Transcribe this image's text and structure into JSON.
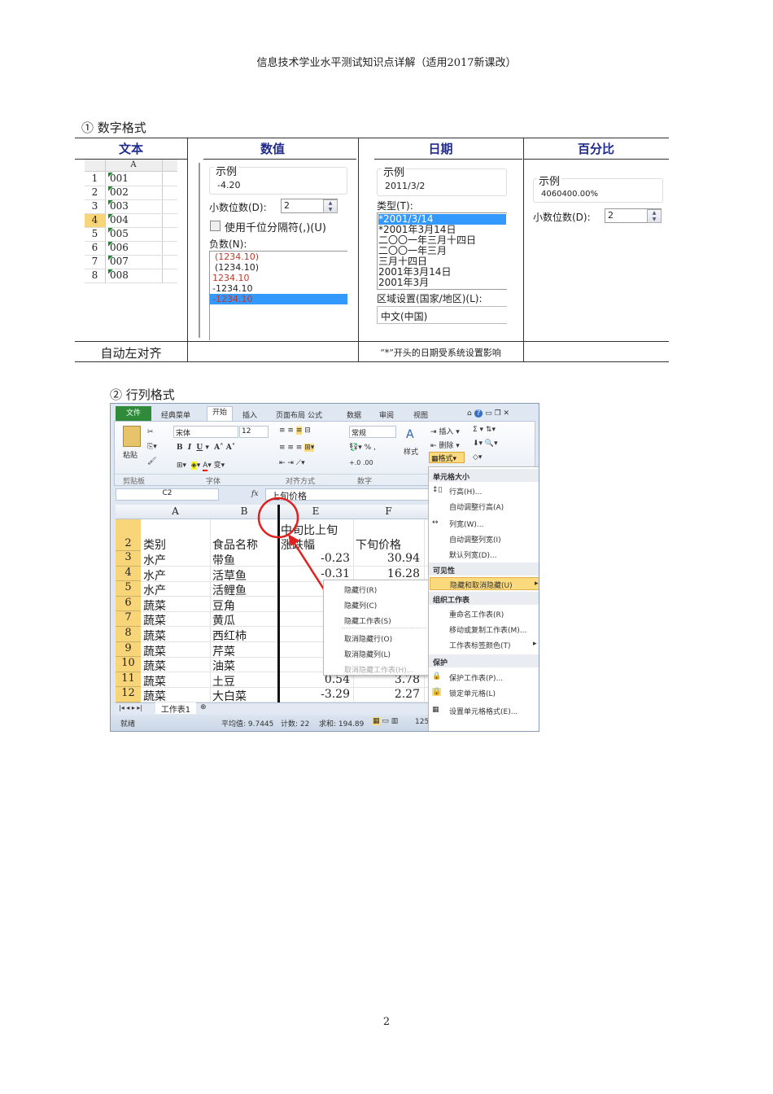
{
  "header": "信息技术学业水平测试知识点详解（适用2017新课改）",
  "section1": {
    "title": "① 数字格式",
    "columns": [
      "文本",
      "数值",
      "日期",
      "百分比"
    ],
    "text": {
      "col_header": "A",
      "rows": [
        "1",
        "2",
        "3",
        "4",
        "5",
        "6",
        "7",
        "8"
      ],
      "values": [
        "001",
        "002",
        "003",
        "004",
        "005",
        "006",
        "007",
        "008"
      ],
      "note": "自动左对齐"
    },
    "number": {
      "sample_label": "示例",
      "sample": "-4.20",
      "decimals_label": "小数位数(D):",
      "decimals": "2",
      "thousands_label": "使用千位分隔符(,)(U)",
      "negative_label": "负数(N):",
      "negatives": [
        "(1234.10)",
        "(1234.10)",
        "1234.10",
        "-1234.10",
        "-1234.10"
      ]
    },
    "date": {
      "sample_label": "示例",
      "sample": "2011/3/2",
      "type_label": "类型(T):",
      "types": [
        "*2001/3/14",
        "*2001年3月14日",
        "二〇〇一年三月十四日",
        "二〇〇一年三月",
        "三月十四日",
        "2001年3月14日",
        "2001年3月"
      ],
      "locale_label": "区域设置(国家/地区)(L):",
      "locale": "中文(中国)",
      "note": "“*”开头的日期受系统设置影响"
    },
    "percent": {
      "sample_label": "示例",
      "sample": "4060400.00%",
      "decimals_label": "小数位数(D):",
      "decimals": "2"
    }
  },
  "section2": {
    "title": "② 行列格式"
  },
  "excel": {
    "tabs": [
      "文件",
      "经典菜单",
      "开始",
      "插入",
      "页面布局",
      "公式",
      "数据",
      "审阅",
      "视图"
    ],
    "font": "宋体",
    "size": "12",
    "number_format": "常规",
    "groups": [
      "剪贴板",
      "字体",
      "对齐方式",
      "数字"
    ],
    "paste": "粘贴",
    "styles": "样式",
    "insert": "插入",
    "delete": "删除",
    "format": "格式",
    "name_box": "C2",
    "fx": "fx",
    "formula": "上旬价格",
    "col_headers": [
      "A",
      "B",
      "E",
      "F"
    ],
    "header_row": {
      "num": "2",
      "a": "类别",
      "b": "食品名称",
      "e1": "中旬比上旬",
      "e2": "涨跌幅",
      "f": "下旬价格"
    },
    "rows": [
      {
        "n": "3",
        "a": "水产",
        "b": "带鱼",
        "e": "-0.23",
        "f": "30.94"
      },
      {
        "n": "4",
        "a": "水产",
        "b": "活草鱼",
        "e": "-0.31",
        "f": "16.28"
      },
      {
        "n": "5",
        "a": "水产",
        "b": "活鲤鱼",
        "e": "",
        "f": ""
      },
      {
        "n": "6",
        "a": "蔬菜",
        "b": "豆角",
        "e": "",
        "f": ""
      },
      {
        "n": "7",
        "a": "蔬菜",
        "b": "黄瓜",
        "e": "",
        "f": ""
      },
      {
        "n": "8",
        "a": "蔬菜",
        "b": "西红柿",
        "e": "",
        "f": ""
      },
      {
        "n": "9",
        "a": "蔬菜",
        "b": "芹菜",
        "e": "",
        "f": ""
      },
      {
        "n": "10",
        "a": "蔬菜",
        "b": "油菜",
        "e": "",
        "f": ""
      },
      {
        "n": "11",
        "a": "蔬菜",
        "b": "土豆",
        "e": "0.54",
        "f": "3.78"
      },
      {
        "n": "12",
        "a": "蔬菜",
        "b": "大白菜",
        "e": "-3.29",
        "f": "2.27"
      }
    ],
    "sheet_tab": "工作表1",
    "status": {
      "ready": "就绪",
      "average": "平均值: 9.7445",
      "count": "计数: 22",
      "sum": "求和: 194.89",
      "zoom": "125"
    },
    "format_menu": {
      "cell_size": "单元格大小",
      "row_height": "行高(H)...",
      "autofit_row": "自动调整行高(A)",
      "col_width": "列宽(W)...",
      "autofit_col": "自动调整列宽(I)",
      "default_width": "默认列宽(D)...",
      "visibility": "可见性",
      "hide_unhide": "隐藏和取消隐藏(U)",
      "organize": "组织工作表",
      "rename": "重命名工作表(R)",
      "move_copy": "移动或复制工作表(M)...",
      "tab_color": "工作表标签颜色(T)",
      "protection": "保护",
      "protect_sheet": "保护工作表(P)...",
      "lock_cell": "锁定单元格(L)",
      "format_cells": "设置单元格格式(E)..."
    },
    "submenu": [
      "隐藏行(R)",
      "隐藏列(C)",
      "隐藏工作表(S)",
      "取消隐藏行(O)",
      "取消隐藏列(L)",
      "取消隐藏工作表(H)..."
    ]
  },
  "page_number": "2",
  "colors": {
    "heading": "#1f2a8a",
    "select": "#3399ff",
    "file_tab": "#2f8a3a",
    "row_header": "#f9d57a",
    "highlight": "#fbd97d",
    "annotation": "#e0201e"
  }
}
